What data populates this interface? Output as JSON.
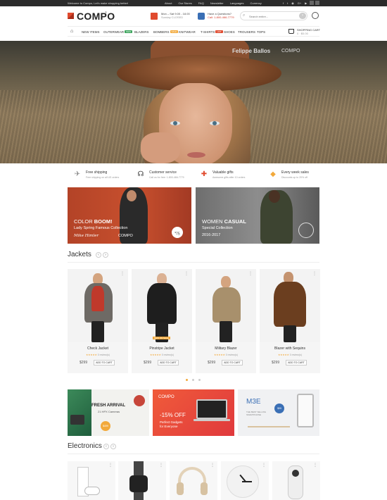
{
  "topbar": {
    "welcome": "Welcome to Compo, Let's make shopping better!",
    "links": [
      "About",
      "Our Stores",
      "FAQ",
      "Newsletter",
      "Languages",
      "Currency"
    ],
    "social": [
      "f",
      "t",
      "◉",
      "G+",
      "▶"
    ]
  },
  "header": {
    "logo": "COMPO",
    "logo_tm": "®",
    "hours_title": "Mon – Sat 9.00 - 18.00",
    "hours_sub": "Sunday CLOSED",
    "question_title": "Have a Questions?",
    "question_sub": "Call: 1-800-466-7779",
    "search_placeholder": "Search entire..."
  },
  "nav": {
    "items": [
      {
        "label": "NEW ITEMS",
        "badge": ""
      },
      {
        "label": "OUTERWEAR",
        "badge": "NEW",
        "badge_color": "#3aa35b"
      },
      {
        "label": "BLAZERS",
        "badge": ""
      },
      {
        "label": "BOMBERS",
        "badge": "SALE",
        "badge_color": "#f2a93b"
      },
      {
        "label": "KNITWEAR",
        "badge": ""
      },
      {
        "label": "T-SHIRTS",
        "badge": "HOT",
        "badge_color": "#e04a2e"
      },
      {
        "label": "SHOES",
        "badge": ""
      },
      {
        "label": "TROUSERS",
        "badge": ""
      },
      {
        "label": "TOPS",
        "badge": ""
      }
    ],
    "cart_title": "SHOPPING CART",
    "cart_value": "0 · $0.00"
  },
  "hero": {
    "person": "Felippe Ballos",
    "brand": "COMPO"
  },
  "features": [
    {
      "icon": "shipping-icon",
      "glyph": "✈",
      "title": "Free shipping",
      "desc": "Free shipping on all US orders"
    },
    {
      "icon": "headset-icon",
      "glyph": "☊",
      "title": "Customer service",
      "desc": "Call us for free: 1-800-466-7779"
    },
    {
      "icon": "gift-icon",
      "glyph": "✚",
      "title": "Valuable gifts",
      "desc": "Awesome gifts after 10 orders"
    },
    {
      "icon": "tag-icon",
      "glyph": "◆",
      "title": "Every week sales",
      "desc": "Discounts up to 20% off"
    }
  ],
  "promos": {
    "left": {
      "line1_a": "COLOR ",
      "line1_b": "BOOM!",
      "line2": "Lady Spring Famous Collection",
      "signature": "Mike Himler",
      "logo": "COMPO",
      "price": "75"
    },
    "right": {
      "line1_a": "WOMEN ",
      "line1_b": "CASUAL",
      "line2": "Special Collection",
      "line3": "2016-2017"
    }
  },
  "jackets": {
    "title": "Jackets",
    "products": [
      {
        "name": "Check Jacket",
        "price": "$299",
        "reviews": "0 review(s)",
        "button": "ADD TO CART",
        "badge": ""
      },
      {
        "name": "Pinstripe Jacket",
        "price": "$299",
        "reviews": "0 review(s)",
        "button": "ADD TO CART",
        "badge": "NEW  ON SALE"
      },
      {
        "name": "Military Blazer",
        "price": "$299",
        "reviews": "0 review(s)",
        "button": "ADD TO CART",
        "badge": ""
      },
      {
        "name": "Blazer with Sequins",
        "price": "$299",
        "reviews": "0 review(s)",
        "button": "ADD TO CART",
        "badge": ""
      }
    ]
  },
  "subbanners": {
    "one": {
      "title": "FRESH ARRIVAL",
      "sub": "21 HPX Cameras",
      "price": "$499"
    },
    "two": {
      "logo": "COMPO",
      "offer": "-15% OFF",
      "line1": "Perfect Gadgets",
      "line2": "for Everyone"
    },
    "three": {
      "title": "M3E",
      "price": "$99",
      "note": "THE BEST SELLING SMARTPHONE"
    }
  },
  "electronics": {
    "title": "Electronics"
  },
  "colors": {
    "accent": "#e04a2e",
    "star": "#f2a93b",
    "dark": "#2b2b2b"
  }
}
